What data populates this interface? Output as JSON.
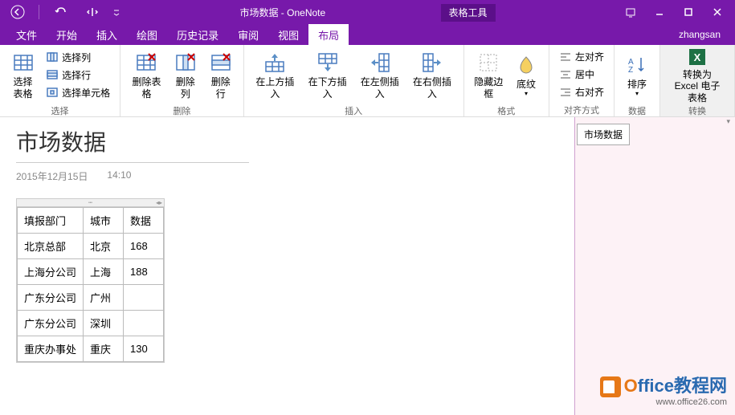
{
  "titlebar": {
    "title": "市场数据 - OneNote",
    "context_tab": "表格工具"
  },
  "menubar": {
    "items": [
      "文件",
      "开始",
      "插入",
      "绘图",
      "历史记录",
      "审阅",
      "视图",
      "布局"
    ],
    "active_index": 7,
    "user": "zhangsan"
  },
  "ribbon": {
    "select": {
      "label": "选择",
      "big": "选择表格",
      "items": [
        "选择列",
        "选择行",
        "选择单元格"
      ]
    },
    "delete": {
      "label": "删除",
      "items": [
        "删除表格",
        "删除列",
        "删除行"
      ]
    },
    "insert": {
      "label": "插入",
      "items": [
        "在上方插入",
        "在下方插入",
        "在左侧插入",
        "在右侧插入"
      ]
    },
    "format": {
      "label": "格式",
      "items": [
        "隐藏边框",
        "底纹"
      ]
    },
    "align": {
      "label": "对齐方式",
      "items": [
        "左对齐",
        "居中",
        "右对齐"
      ]
    },
    "data": {
      "label": "数据",
      "items": [
        "排序"
      ]
    },
    "convert": {
      "label": "转换",
      "items": [
        "转换为 Excel 电子表格"
      ]
    }
  },
  "page": {
    "title": "市场数据",
    "date": "2015年12月15日",
    "time": "14:10",
    "sidebar_tab": "市场数据"
  },
  "chart_data": {
    "type": "table",
    "headers": [
      "填报部门",
      "城市",
      "数据"
    ],
    "rows": [
      [
        "北京总部",
        "北京",
        "168"
      ],
      [
        "上海分公司",
        "上海",
        "188"
      ],
      [
        "广东分公司",
        "广州",
        ""
      ],
      [
        "广东分公司",
        "深圳",
        ""
      ],
      [
        "重庆办事处",
        "重庆",
        "130"
      ]
    ]
  },
  "watermark": {
    "brand_o": "O",
    "brand_rest": "ffice教程网",
    "url": "www.office26.com"
  }
}
